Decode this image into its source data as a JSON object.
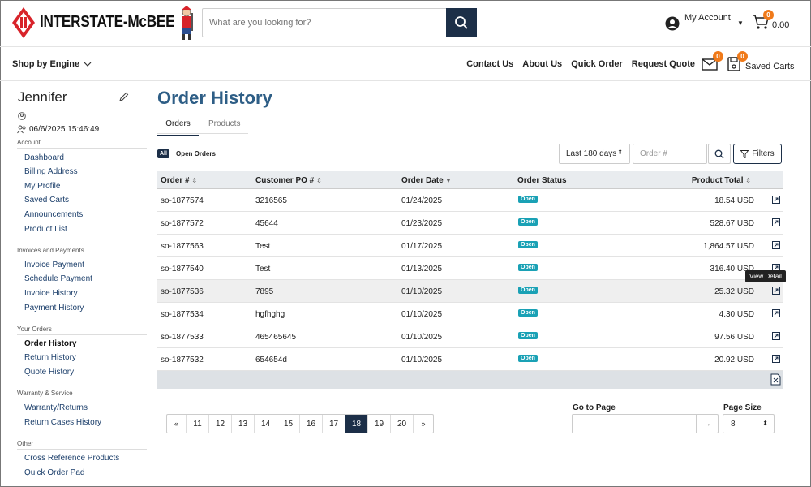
{
  "header": {
    "logo_text": "INTERSTATE-McBEE",
    "search_placeholder": "What are you looking for?",
    "account_label": "My Account",
    "cart_count": "0",
    "cart_total": "0.00"
  },
  "nav": {
    "shop_by_engine": "Shop by Engine",
    "links": [
      "Contact Us",
      "About Us",
      "Quick Order",
      "Request Quote"
    ],
    "mail_count": "0",
    "saved_count": "0",
    "saved_label": "Saved Carts"
  },
  "sidebar": {
    "user_name": "Jennifer",
    "last_login": "06/6/2025 15:46:49",
    "sections": [
      {
        "title": "Account",
        "items": [
          "Dashboard",
          "Billing Address",
          "My Profile",
          "Saved Carts",
          "Announcements",
          "Product List"
        ]
      },
      {
        "title": "Invoices and Payments",
        "items": [
          "Invoice Payment",
          "Schedule Payment",
          "Invoice History",
          "Payment History"
        ]
      },
      {
        "title": "Your Orders",
        "items": [
          "Order History",
          "Return History",
          "Quote History"
        ]
      },
      {
        "title": "Warranty & Service",
        "items": [
          "Warranty/Returns",
          "Return Cases History"
        ]
      },
      {
        "title": "Other",
        "items": [
          "Cross Reference Products",
          "Quick Order Pad"
        ]
      }
    ],
    "active_item": "Order History"
  },
  "main": {
    "title": "Order History",
    "tabs": [
      "Orders",
      "Products"
    ],
    "all_pill": "All",
    "open_orders": "Open Orders",
    "period": "Last 180 days",
    "order_placeholder": "Order #",
    "filters_label": "Filters",
    "columns": [
      "Order #",
      "Customer PO #",
      "Order Date",
      "Order Status",
      "Product Total"
    ],
    "rows": [
      {
        "order": "so-1877574",
        "po": "3216565",
        "date": "01/24/2025",
        "status": "Open",
        "total": "18.54 USD"
      },
      {
        "order": "so-1877572",
        "po": "45644",
        "date": "01/23/2025",
        "status": "Open",
        "total": "528.67 USD"
      },
      {
        "order": "so-1877563",
        "po": "Test",
        "date": "01/17/2025",
        "status": "Open",
        "total": "1,864.57 USD"
      },
      {
        "order": "so-1877540",
        "po": "Test",
        "date": "01/13/2025",
        "status": "Open",
        "total": "316.40 USD"
      },
      {
        "order": "so-1877536",
        "po": "7895",
        "date": "01/10/2025",
        "status": "Open",
        "total": "25.32 USD"
      },
      {
        "order": "so-1877534",
        "po": "hgfhghg",
        "date": "01/10/2025",
        "status": "Open",
        "total": "4.30 USD"
      },
      {
        "order": "so-1877533",
        "po": "465465645",
        "date": "01/10/2025",
        "status": "Open",
        "total": "97.56 USD"
      },
      {
        "order": "so-1877532",
        "po": "654654d",
        "date": "01/10/2025",
        "status": "Open",
        "total": "20.92 USD"
      }
    ],
    "tooltip": "View Detail",
    "pager": {
      "prev": "«",
      "pages": [
        "11",
        "12",
        "13",
        "14",
        "15",
        "16",
        "17",
        "18",
        "19",
        "20"
      ],
      "current": "18",
      "next": "»"
    },
    "goto_label": "Go to Page",
    "page_size_label": "Page Size",
    "page_size": "8"
  },
  "colors": {
    "navy": "#1c2f48",
    "title_blue": "#2e5e86",
    "badge_orange": "#f07a1a",
    "status_teal": "#1aa1b5",
    "logo_red": "#d8232a"
  }
}
